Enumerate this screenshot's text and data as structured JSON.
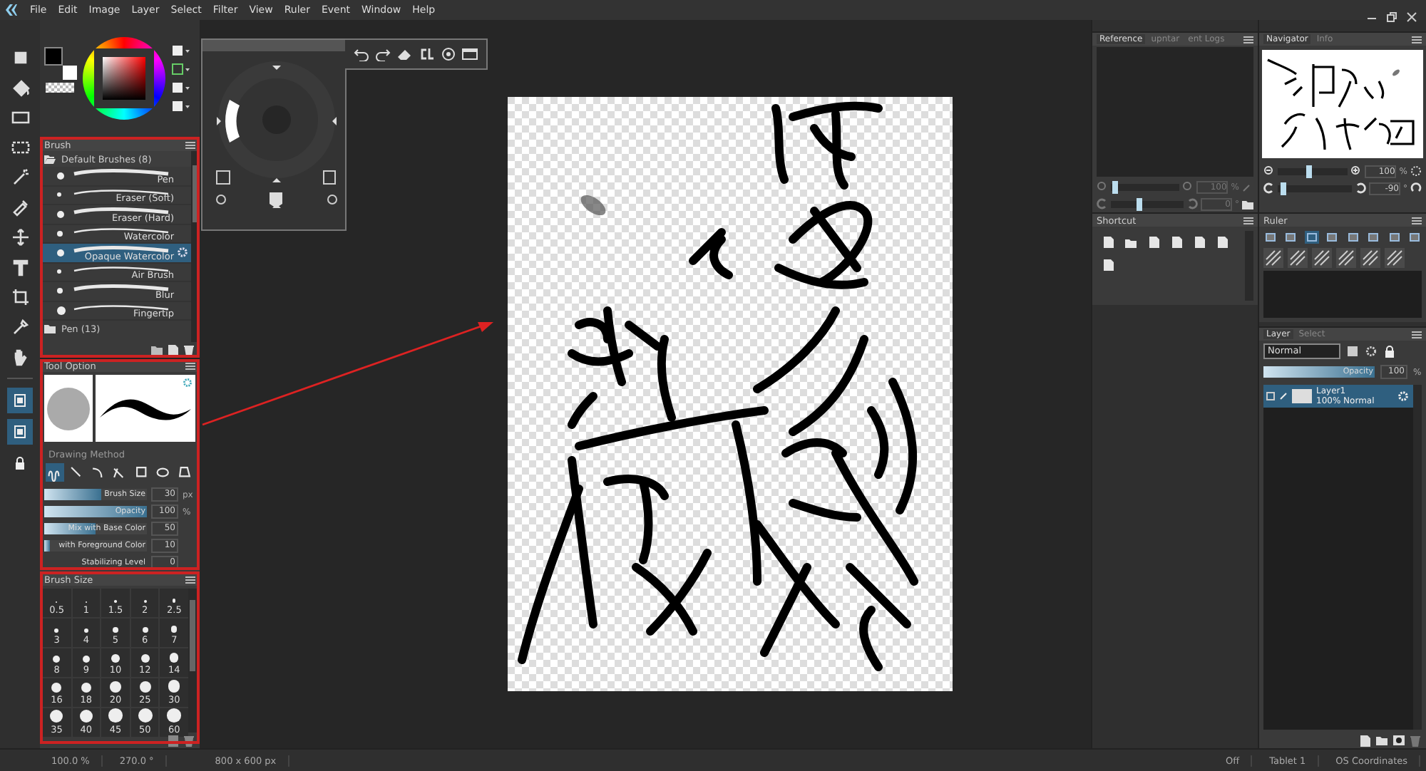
{
  "menu": [
    "File",
    "Edit",
    "Image",
    "Layer",
    "Select",
    "Filter",
    "View",
    "Ruler",
    "Event",
    "Window",
    "Help"
  ],
  "tool_toggles": [
    {
      "selected": true
    },
    {
      "selected": true
    },
    {
      "selected": false
    }
  ],
  "brush_panel": {
    "title": "Brush",
    "groups": [
      {
        "name": "Default Brushes (8)",
        "expanded": true,
        "brushes": [
          {
            "name": "Pen",
            "selected": false
          },
          {
            "name": "Eraser (Soft)",
            "selected": false
          },
          {
            "name": "Eraser (Hard)",
            "selected": false
          },
          {
            "name": "Watercolor",
            "selected": false
          },
          {
            "name": "Opaque Watercolor",
            "selected": true
          },
          {
            "name": "Air Brush",
            "selected": false
          },
          {
            "name": "Blur",
            "selected": false
          },
          {
            "name": "Fingertip",
            "selected": false
          }
        ]
      },
      {
        "name": "Pen (13)",
        "expanded": false
      }
    ]
  },
  "tool_option": {
    "title": "Tool Option",
    "section": "Drawing Method",
    "methods": [
      {
        "selected": true
      },
      {
        "selected": false
      },
      {
        "selected": false
      },
      {
        "selected": false
      },
      {
        "selected": false
      },
      {
        "selected": false
      },
      {
        "selected": false
      }
    ],
    "sliders": [
      {
        "label": "Brush Size",
        "level": 0.55,
        "value": "30",
        "unit": "px"
      },
      {
        "label": "Opacity",
        "level": 1,
        "value": "100",
        "unit": "%"
      },
      {
        "label": "Mix with Base Color",
        "level": 0.5,
        "value": "50"
      },
      {
        "label": "with Foreground Color",
        "level": 0.06,
        "value": "10"
      },
      {
        "label": "Stabilizing Level",
        "value": "0"
      }
    ]
  },
  "brush_size": {
    "title": "Brush Size",
    "sizes": [
      "0.5",
      "1",
      "1.5",
      "2",
      "2.5",
      "3",
      "4",
      "5",
      "6",
      "7",
      "8",
      "9",
      "10",
      "12",
      "14",
      "16",
      "18",
      "20",
      "25",
      "30",
      "35",
      "40",
      "45",
      "50",
      "60"
    ]
  },
  "reference": {
    "tabs": [
      {
        "label": "Reference",
        "selected": true
      },
      {
        "label": "upntar",
        "selected": false
      },
      {
        "label": "ent Logs",
        "selected": false
      }
    ],
    "zoom_slider": {
      "level": 0.02
    },
    "zoom": "100",
    "zoom_unit": "%",
    "angle_slider": {
      "level": 0.4
    },
    "angle": "0",
    "angle_unit": "°"
  },
  "navigator": {
    "tabs": [
      {
        "label": "Navigator",
        "selected": true
      },
      {
        "label": "Info",
        "selected": false
      }
    ],
    "zoom_slider": {
      "level": 0.45
    },
    "zoom": "100",
    "zoom_unit": "%",
    "angle_slider": {
      "level": 0.05
    },
    "angle": "-90",
    "angle_unit": "°"
  },
  "shortcut": {
    "title": "Shortcut"
  },
  "ruler": {
    "title": "Ruler"
  },
  "layer": {
    "tabs": [
      {
        "label": "Layer",
        "selected": true
      },
      {
        "label": "Select",
        "selected": false
      }
    ],
    "blend_mode": "Normal",
    "opacity": {
      "label": "Opacity",
      "level": 1,
      "value": "100",
      "unit": "%"
    },
    "layers": [
      {
        "name": "Layer1",
        "detail": "100% Normal",
        "selected": true
      }
    ]
  },
  "status_bar": {
    "zoom": "100.0 %",
    "angle": "270.0 °",
    "size": "800 x 600 px",
    "right": [
      "Off",
      "Tablet 1",
      "OS Coordinates"
    ]
  }
}
